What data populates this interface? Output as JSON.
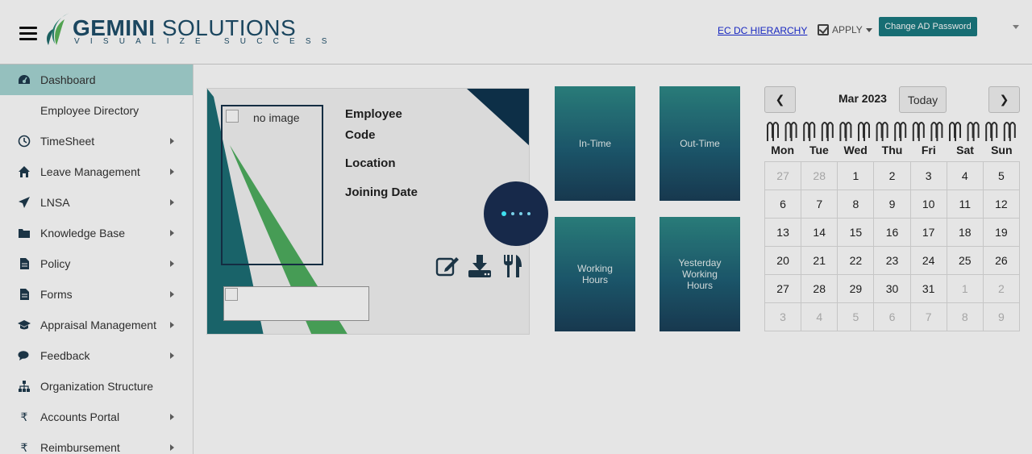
{
  "header": {
    "brand_name_1": "GEMINI",
    "brand_name_2": "SOLUTIONS",
    "brand_tagline": "VISUALIZE SUCCESS",
    "ec_dc_link": "EC DC HIERARCHY",
    "apply_label": "APPLY",
    "change_password_label": "Change AD Password",
    "icons": {
      "menu": "hamburger-menu-icon",
      "apply": "checkbox-icon",
      "dropdown": "caret-down-icon"
    }
  },
  "sidebar": {
    "items": [
      {
        "label": "Dashboard",
        "icon": "dashboard-icon",
        "active": true,
        "submenu": false
      },
      {
        "label": "Employee Directory",
        "icon": "",
        "active": false,
        "submenu": false
      },
      {
        "label": "TimeSheet",
        "icon": "clock-icon",
        "active": false,
        "submenu": true
      },
      {
        "label": "Leave Management",
        "icon": "home-icon",
        "active": false,
        "submenu": true
      },
      {
        "label": "LNSA",
        "icon": "paper-plane-icon",
        "active": false,
        "submenu": true
      },
      {
        "label": "Knowledge Base",
        "icon": "folder-icon",
        "active": false,
        "submenu": true
      },
      {
        "label": "Policy",
        "icon": "file-icon",
        "active": false,
        "submenu": true
      },
      {
        "label": "Forms",
        "icon": "file-icon",
        "active": false,
        "submenu": true
      },
      {
        "label": "Appraisal Management",
        "icon": "graduation-cap-icon",
        "active": false,
        "submenu": true
      },
      {
        "label": "Feedback",
        "icon": "comments-icon",
        "active": false,
        "submenu": true
      },
      {
        "label": "Organization Structure",
        "icon": "sitemap-icon",
        "active": false,
        "submenu": false
      },
      {
        "label": "Accounts Portal",
        "icon": "rupee-icon",
        "active": false,
        "submenu": true
      },
      {
        "label": "Reimbursement",
        "icon": "rupee-icon",
        "active": false,
        "submenu": true
      }
    ]
  },
  "profile": {
    "photo_alt": "no image",
    "employee_code_line1": "Employee",
    "employee_code_line2": "Code",
    "location_label": "Location",
    "joining_date_label": "Joining Date",
    "actions": [
      "edit-profile-icon",
      "download-icon",
      "food-menu-icon"
    ]
  },
  "tiles": {
    "in_time": "In-Time",
    "out_time": "Out-Time",
    "working_hours_1": "Working",
    "working_hours_2": "Hours",
    "yesterday_1": "Yesterday",
    "yesterday_2": "Working",
    "yesterday_3": "Hours"
  },
  "calendar": {
    "month_label": "Mar 2023",
    "today_label": "Today",
    "prev": "❮",
    "next": "❯",
    "weekdays": [
      "Mon",
      "Tue",
      "Wed",
      "Thu",
      "Fri",
      "Sat",
      "Sun"
    ],
    "weeks": [
      [
        {
          "d": "27",
          "m": true
        },
        {
          "d": "28",
          "m": true
        },
        {
          "d": "1"
        },
        {
          "d": "2"
        },
        {
          "d": "3"
        },
        {
          "d": "4"
        },
        {
          "d": "5"
        }
      ],
      [
        {
          "d": "6"
        },
        {
          "d": "7"
        },
        {
          "d": "8"
        },
        {
          "d": "9"
        },
        {
          "d": "10"
        },
        {
          "d": "11"
        },
        {
          "d": "12"
        }
      ],
      [
        {
          "d": "13"
        },
        {
          "d": "14"
        },
        {
          "d": "15"
        },
        {
          "d": "16"
        },
        {
          "d": "17"
        },
        {
          "d": "18"
        },
        {
          "d": "19"
        }
      ],
      [
        {
          "d": "20"
        },
        {
          "d": "21"
        },
        {
          "d": "22"
        },
        {
          "d": "23"
        },
        {
          "d": "24"
        },
        {
          "d": "25"
        },
        {
          "d": "26"
        }
      ],
      [
        {
          "d": "27"
        },
        {
          "d": "28"
        },
        {
          "d": "29"
        },
        {
          "d": "30"
        },
        {
          "d": "31"
        },
        {
          "d": "1",
          "m": true
        },
        {
          "d": "2",
          "m": true
        }
      ],
      [
        {
          "d": "3",
          "m": true
        },
        {
          "d": "4",
          "m": true
        },
        {
          "d": "5",
          "m": true
        },
        {
          "d": "6",
          "m": true
        },
        {
          "d": "7",
          "m": true
        },
        {
          "d": "8",
          "m": true
        },
        {
          "d": "9",
          "m": true
        }
      ]
    ]
  },
  "loading": {
    "icon": "loading-spinner-icon"
  }
}
